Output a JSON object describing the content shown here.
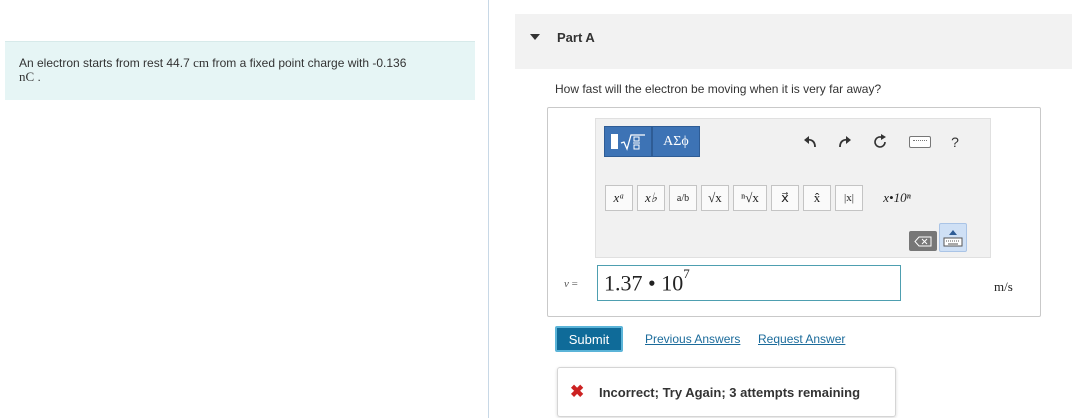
{
  "problem": {
    "text": "An electron starts from rest 44.7 ",
    "distance_unit": "cm",
    "text2": " from a fixed point charge with -0.136",
    "charge_unit": "nC"
  },
  "part": {
    "title": "Part A"
  },
  "question": "How fast will the electron be moving when it is very far away?",
  "toolbar": {
    "greek_label": "ΑΣϕ",
    "math_buttons": [
      "xᵃ",
      "x♭",
      "a/b",
      "√x",
      "ⁿ√x",
      "x⃗",
      "x̂",
      "|x|",
      "x•10ⁿ"
    ],
    "undo_icon": "undo-icon",
    "redo_icon": "redo-icon",
    "reset_icon": "reset-icon",
    "keyboard_icon": "keyboard-icon",
    "help_label": "?"
  },
  "answer": {
    "var_label": "v",
    "eq": "=",
    "mantissa": "1.37",
    "dot": " • ",
    "base": "10",
    "exponent": "7",
    "unit": "m/s"
  },
  "actions": {
    "submit": "Submit",
    "previous_answers": "Previous Answers",
    "request_answer": "Request Answer"
  },
  "feedback": {
    "message": "Incorrect; Try Again; 3 attempts remaining",
    "status_color": "#cc2222"
  }
}
